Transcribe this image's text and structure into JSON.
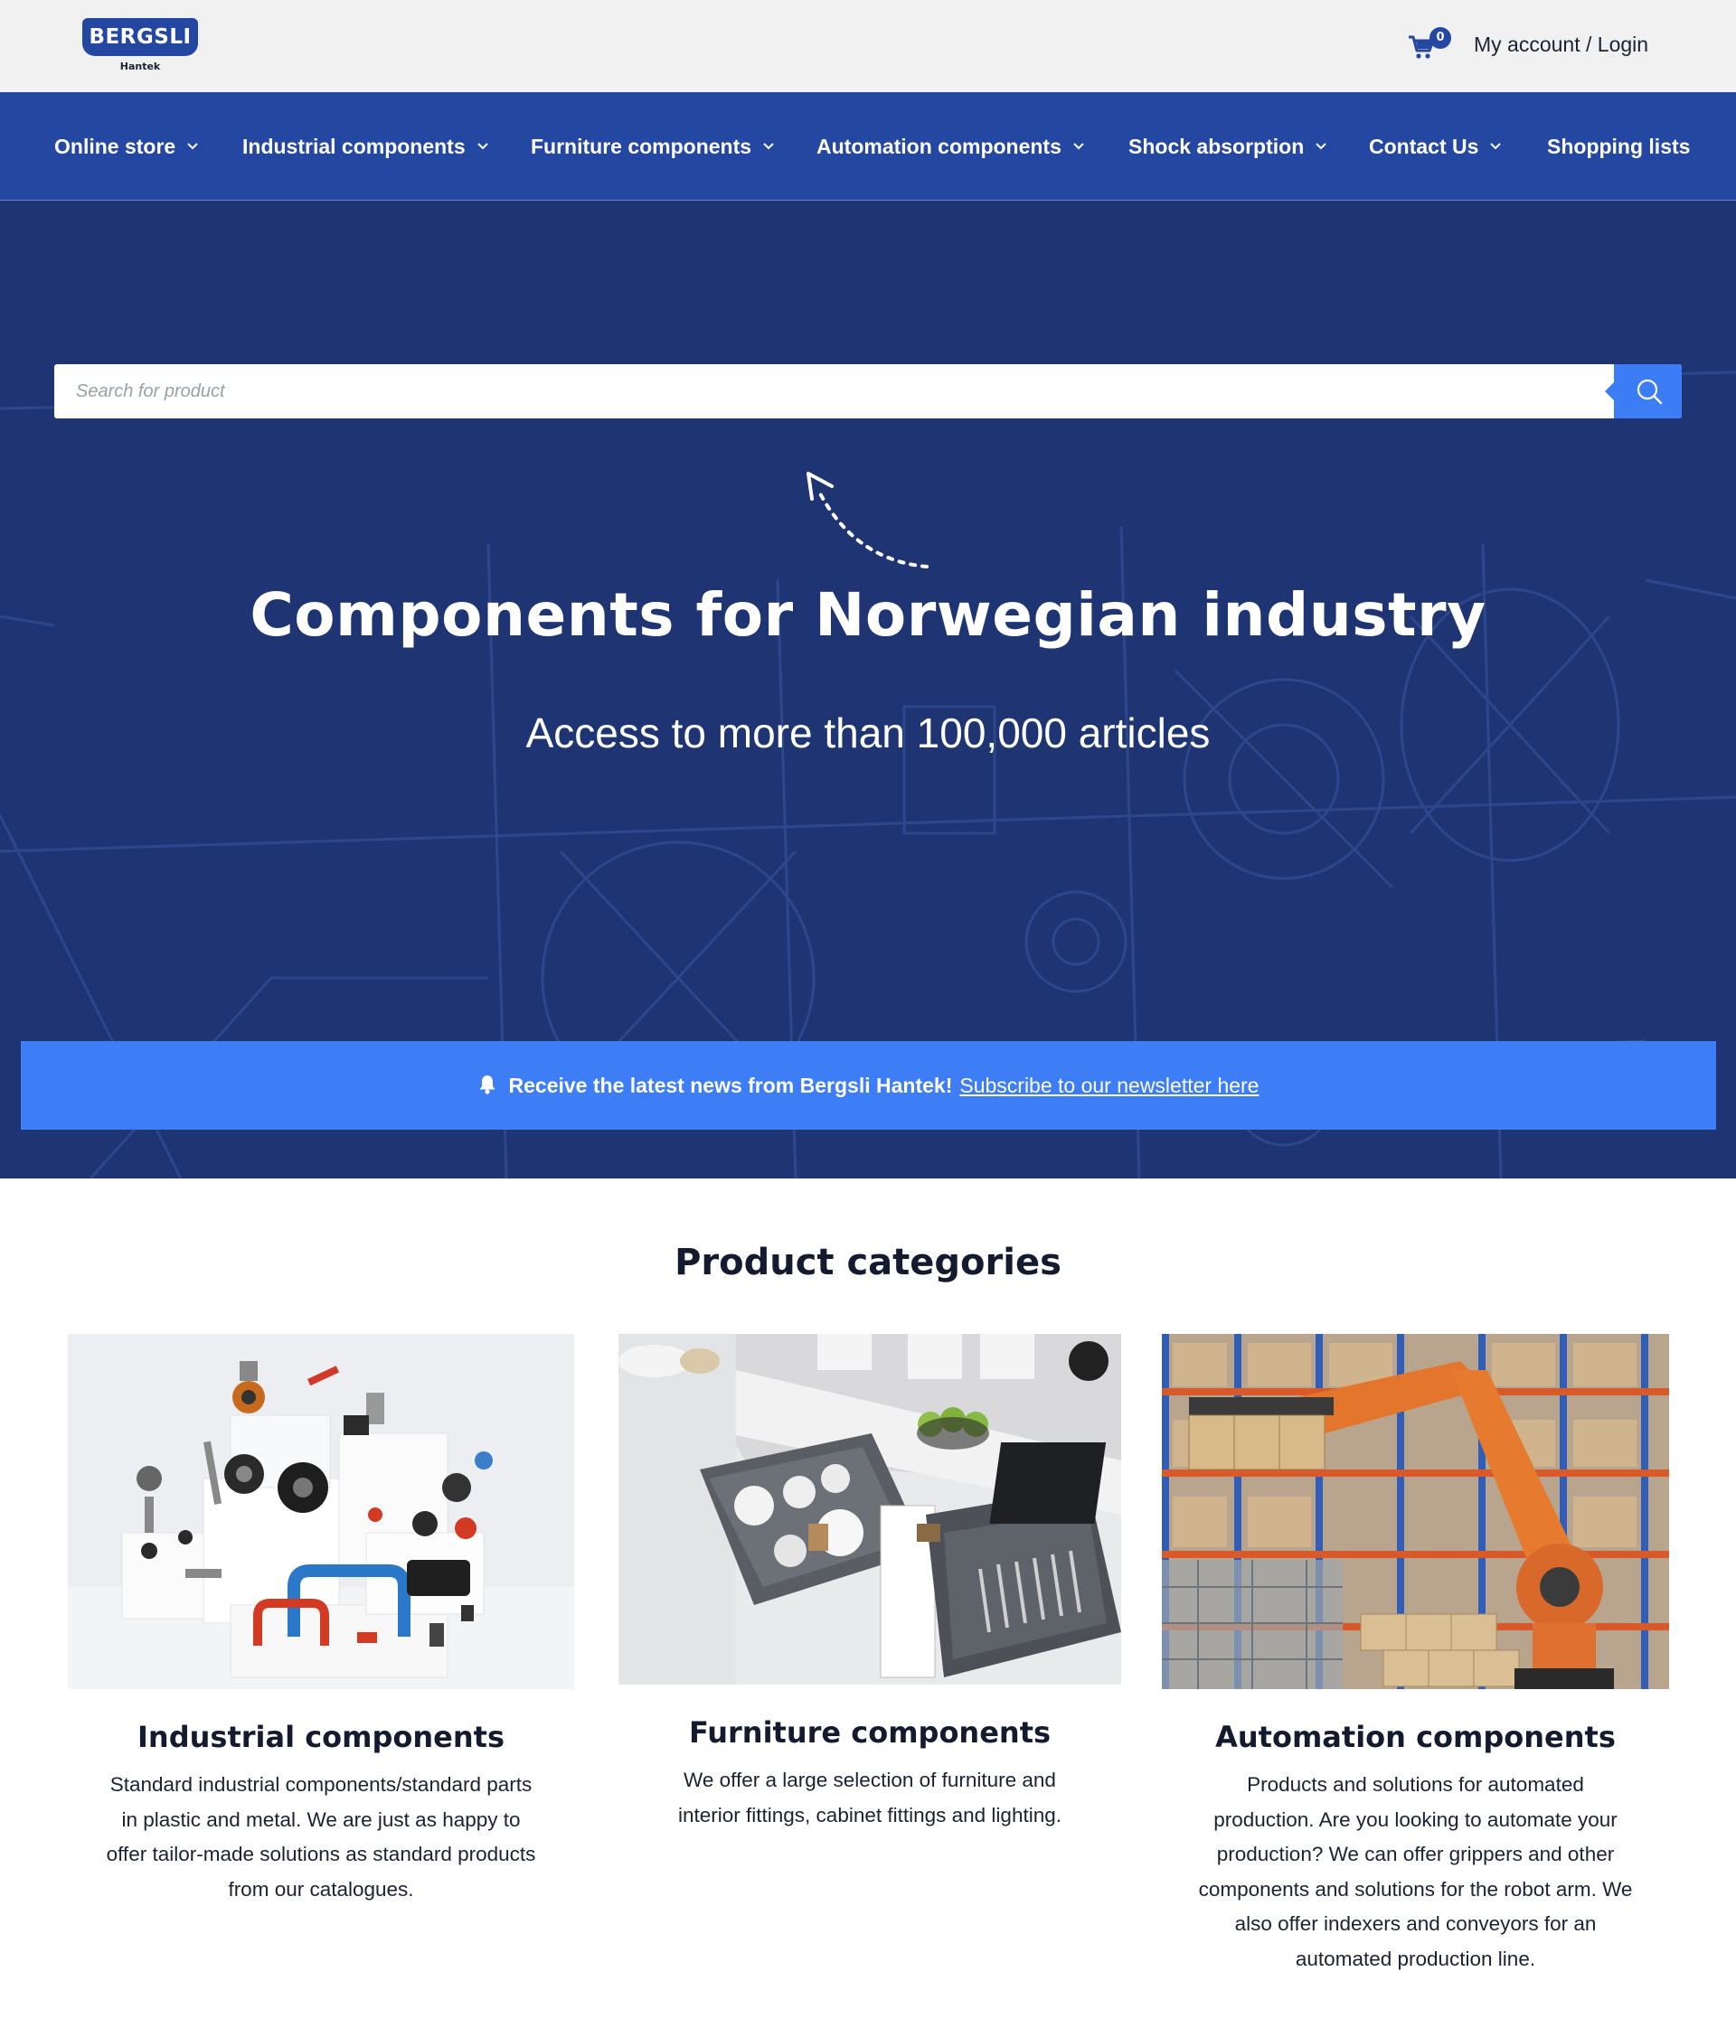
{
  "header": {
    "logo_text": "BERGSLI",
    "logo_sub": "Hantek",
    "cart_count": "0",
    "account_label": "My account / Login"
  },
  "nav": {
    "items": [
      {
        "label": "Online store",
        "has_dropdown": true
      },
      {
        "label": "Industrial components",
        "has_dropdown": true
      },
      {
        "label": "Furniture components",
        "has_dropdown": true
      },
      {
        "label": "Automation components",
        "has_dropdown": true
      },
      {
        "label": "Shock absorption",
        "has_dropdown": true
      },
      {
        "label": "Contact Us",
        "has_dropdown": true
      },
      {
        "label": "Shopping lists",
        "has_dropdown": false
      }
    ]
  },
  "hero": {
    "search_placeholder": "Search for product",
    "title": "Components for Norwegian industry",
    "subtitle": "Access to more than 100,000 articles"
  },
  "newsletter": {
    "bold_text": "Receive the latest news from Bergsli Hantek!",
    "link_text": "Subscribe to our newsletter here"
  },
  "categories": {
    "title": "Product categories",
    "items": [
      {
        "title": "Industrial components",
        "lines": [
          "Standard industrial components/standard parts",
          "in plastic and metal. We are just as happy to",
          "offer tailor-made solutions as standard products",
          "from our catalogues."
        ]
      },
      {
        "title": "Furniture components",
        "lines": [
          "We offer a large selection of furniture and",
          "interior fittings, cabinet fittings and lighting."
        ]
      },
      {
        "title": "Automation components",
        "lines": [
          "Products and solutions for automated",
          "production. Are you looking to automate your",
          "production? We can offer grippers and other",
          "components and solutions for the robot arm. We",
          "also offer indexers and conveyors for an",
          "automated production line."
        ]
      }
    ]
  },
  "colors": {
    "brand_blue": "#2447a1",
    "hero_navy": "#1f3573",
    "accent_blue": "#3d7ef6"
  }
}
